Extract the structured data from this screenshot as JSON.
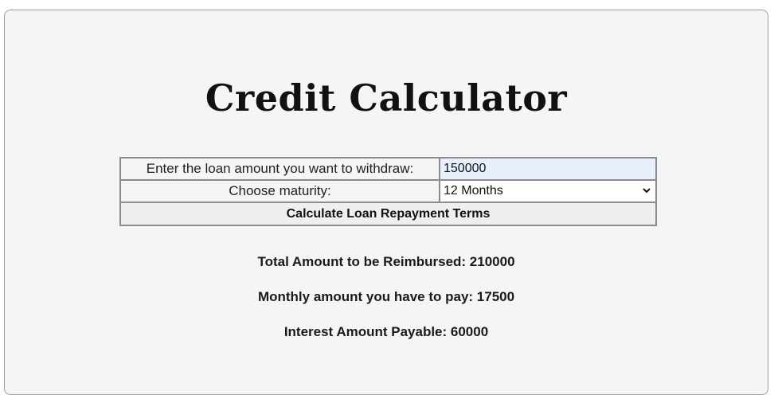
{
  "page": {
    "title": "Credit Calculator"
  },
  "form": {
    "amount_label": "Enter the loan amount you want to withdraw:",
    "amount_value": "150000",
    "maturity_label": "Choose maturity:",
    "maturity_selected": "12 Months",
    "submit_label": "Calculate Loan Repayment Terms"
  },
  "results": {
    "total_reimbursed": "Total Amount to be Reimbursed: 210000",
    "monthly_payment": "Monthly amount you have to pay: 17500",
    "interest_payable": "Interest Amount Payable: 60000"
  },
  "icons": {
    "maturity_dropdown": "chevron-down-icon"
  },
  "colors": {
    "card_background": "#f5f5f5",
    "input_autofill_background": "#e8f0fe",
    "button_background": "#efefef",
    "table_border": "#8c8c8c"
  }
}
